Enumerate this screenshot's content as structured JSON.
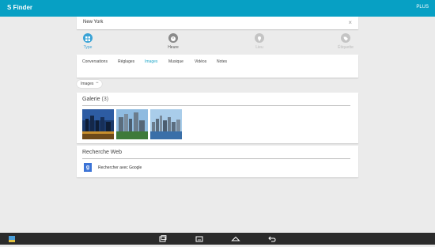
{
  "app": {
    "title": "S Finder",
    "plus_label": "PLUS"
  },
  "search": {
    "value": "New York",
    "clear_glyph": "×"
  },
  "filters": [
    {
      "label": "Type",
      "state": "selected",
      "color": "#3aa3d6",
      "icon": "grid-icon"
    },
    {
      "label": "Heure",
      "state": "normal",
      "color": "#8a8a8a",
      "icon": "clock-icon"
    },
    {
      "label": "Lieu",
      "state": "disabled",
      "color": "#c4c4c4",
      "icon": "location-icon"
    },
    {
      "label": "Étiquette",
      "state": "disabled",
      "color": "#c4c4c4",
      "icon": "tag-icon"
    }
  ],
  "tabs": [
    {
      "label": "Conversations",
      "active": false
    },
    {
      "label": "Réglages",
      "active": false
    },
    {
      "label": "Images",
      "active": true
    },
    {
      "label": "Musique",
      "active": false
    },
    {
      "label": "Vidéos",
      "active": false
    },
    {
      "label": "Notes",
      "active": false
    }
  ],
  "chip": {
    "label": "Images",
    "remove_glyph": "−"
  },
  "galerie": {
    "title": "Galerie",
    "count": "(3)"
  },
  "web": {
    "title": "Recherche Web",
    "link": "Rechercher avec Google",
    "icon_letter": "g"
  },
  "navbar": {
    "icons": [
      "app-icon",
      "recent-apps-icon",
      "menu-icon",
      "home-icon",
      "back-icon"
    ]
  },
  "colors": {
    "accent": "#07a0c4",
    "active_tab": "#21a8c9",
    "navbar": "#2b2b2b"
  }
}
